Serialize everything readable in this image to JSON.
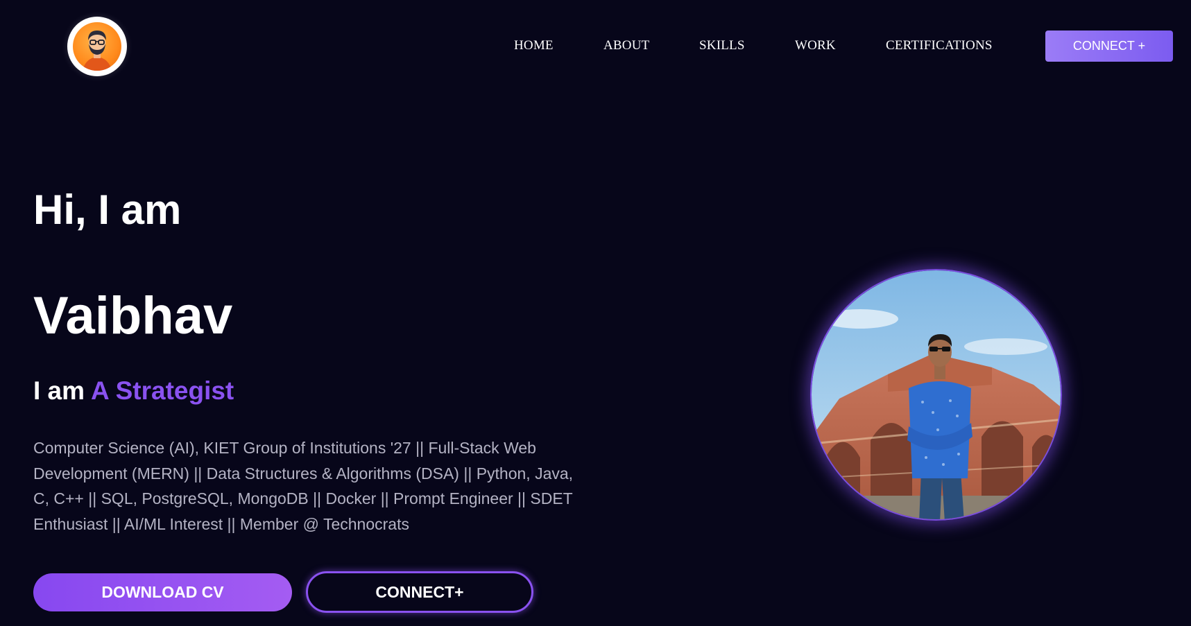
{
  "header": {
    "logo_icon": "avatar-logo-icon",
    "nav": [
      {
        "label": "HOME"
      },
      {
        "label": "ABOUT"
      },
      {
        "label": "SKILLS"
      },
      {
        "label": "WORK"
      },
      {
        "label": "CERTIFICATIONS"
      }
    ],
    "connect_label": "CONNECT +"
  },
  "hero": {
    "greeting": "Hi, I am",
    "name": "Vaibhav",
    "role_prefix": "I am",
    "role_highlight": "A Strategist",
    "bio": "Computer Science (AI), KIET Group of Institutions '27 || Full-Stack Web Development (MERN) || Data Structures & Algorithms (DSA) || Python, Java, C, C++ || SQL, PostgreSQL, MongoDB || Docker || Prompt Engineer || SDET Enthusiast || AI/ML Interest || Member @ Technocrats",
    "download_cv_label": "DOWNLOAD CV",
    "connect_label": "CONNECT+",
    "portrait_icon": "profile-photo"
  },
  "colors": {
    "background": "#07061a",
    "accent": "#8a52f0",
    "bio_text": "#b4b3c4"
  }
}
